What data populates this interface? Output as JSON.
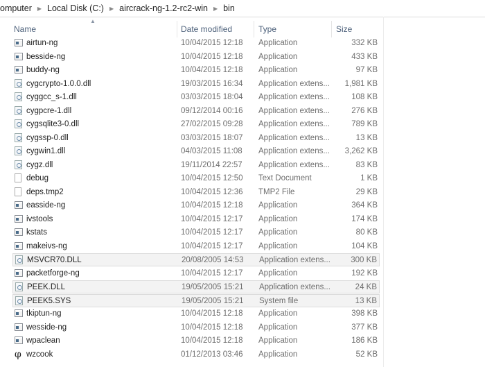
{
  "breadcrumb": [
    "omputer",
    "Local Disk (C:)",
    "aircrack-ng-1.2-rc2-win",
    "bin"
  ],
  "columns": {
    "name": "Name",
    "date": "Date modified",
    "type": "Type",
    "size": "Size"
  },
  "files": [
    {
      "name": "airtun-ng",
      "date": "10/04/2015 12:18",
      "type": "Application",
      "size": "332 KB",
      "icon": "app"
    },
    {
      "name": "besside-ng",
      "date": "10/04/2015 12:18",
      "type": "Application",
      "size": "433 KB",
      "icon": "app"
    },
    {
      "name": "buddy-ng",
      "date": "10/04/2015 12:18",
      "type": "Application",
      "size": "97 KB",
      "icon": "app"
    },
    {
      "name": "cygcrypto-1.0.0.dll",
      "date": "19/03/2015 16:34",
      "type": "Application extens...",
      "size": "1,981 KB",
      "icon": "dll"
    },
    {
      "name": "cyggcc_s-1.dll",
      "date": "03/03/2015 18:04",
      "type": "Application extens...",
      "size": "108 KB",
      "icon": "dll"
    },
    {
      "name": "cygpcre-1.dll",
      "date": "09/12/2014 00:16",
      "type": "Application extens...",
      "size": "276 KB",
      "icon": "dll"
    },
    {
      "name": "cygsqlite3-0.dll",
      "date": "27/02/2015 09:28",
      "type": "Application extens...",
      "size": "789 KB",
      "icon": "dll"
    },
    {
      "name": "cygssp-0.dll",
      "date": "03/03/2015 18:07",
      "type": "Application extens...",
      "size": "13 KB",
      "icon": "dll"
    },
    {
      "name": "cygwin1.dll",
      "date": "04/03/2015 11:08",
      "type": "Application extens...",
      "size": "3,262 KB",
      "icon": "dll"
    },
    {
      "name": "cygz.dll",
      "date": "19/11/2014 22:57",
      "type": "Application extens...",
      "size": "83 KB",
      "icon": "dll"
    },
    {
      "name": "debug",
      "date": "10/04/2015 12:50",
      "type": "Text Document",
      "size": "1 KB",
      "icon": "doc"
    },
    {
      "name": "deps.tmp2",
      "date": "10/04/2015 12:36",
      "type": "TMP2 File",
      "size": "29 KB",
      "icon": "doc"
    },
    {
      "name": "easside-ng",
      "date": "10/04/2015 12:18",
      "type": "Application",
      "size": "364 KB",
      "icon": "app"
    },
    {
      "name": "ivstools",
      "date": "10/04/2015 12:17",
      "type": "Application",
      "size": "174 KB",
      "icon": "app"
    },
    {
      "name": "kstats",
      "date": "10/04/2015 12:17",
      "type": "Application",
      "size": "80 KB",
      "icon": "app"
    },
    {
      "name": "makeivs-ng",
      "date": "10/04/2015 12:17",
      "type": "Application",
      "size": "104 KB",
      "icon": "app"
    },
    {
      "name": "MSVCR70.DLL",
      "date": "20/08/2005 14:53",
      "type": "Application extens...",
      "size": "300 KB",
      "icon": "dll",
      "selected": true
    },
    {
      "name": "packetforge-ng",
      "date": "10/04/2015 12:17",
      "type": "Application",
      "size": "192 KB",
      "icon": "app"
    },
    {
      "name": "PEEK.DLL",
      "date": "19/05/2005 15:21",
      "type": "Application extens...",
      "size": "24 KB",
      "icon": "dll",
      "selected": true
    },
    {
      "name": "PEEK5.SYS",
      "date": "19/05/2005 15:21",
      "type": "System file",
      "size": "13 KB",
      "icon": "dll",
      "selected": true
    },
    {
      "name": "tkiptun-ng",
      "date": "10/04/2015 12:18",
      "type": "Application",
      "size": "398 KB",
      "icon": "app"
    },
    {
      "name": "wesside-ng",
      "date": "10/04/2015 12:18",
      "type": "Application",
      "size": "377 KB",
      "icon": "app"
    },
    {
      "name": "wpaclean",
      "date": "10/04/2015 12:18",
      "type": "Application",
      "size": "186 KB",
      "icon": "app"
    },
    {
      "name": "wzcook",
      "date": "01/12/2013 03:46",
      "type": "Application",
      "size": "52 KB",
      "icon": "phi"
    }
  ]
}
